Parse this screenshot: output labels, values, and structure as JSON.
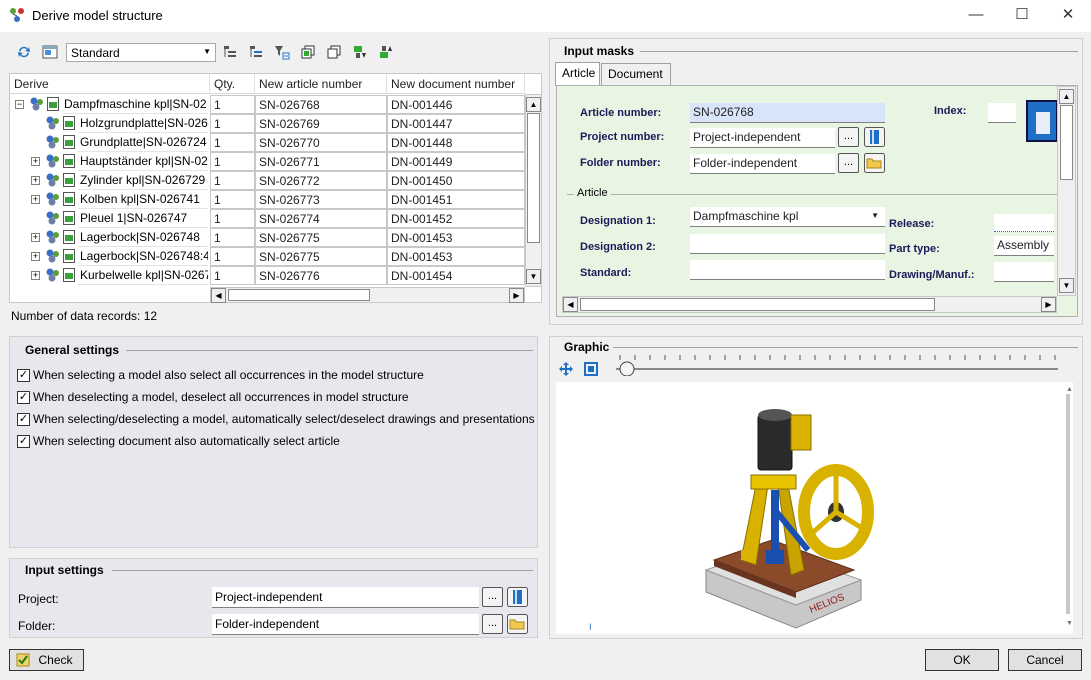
{
  "window": {
    "title": "Derive model structure",
    "minimize": "—",
    "maximize": "☐",
    "close": "✕"
  },
  "toolbar": {
    "view_combo": "Standard"
  },
  "tree": {
    "columns": [
      "Derive",
      "Qty.",
      "New article number",
      "New document number"
    ],
    "rows": [
      {
        "name": "Dampfmaschine kpl|SN-02",
        "qty": "1",
        "art": "SN-026768",
        "doc": "DN-001446",
        "expander": "−",
        "level": 0
      },
      {
        "name": "Holzgrundplatte|SN-026",
        "qty": "1",
        "art": "SN-026769",
        "doc": "DN-001447",
        "expander": "",
        "level": 1
      },
      {
        "name": "Grundplatte|SN-026724",
        "qty": "1",
        "art": "SN-026770",
        "doc": "DN-001448",
        "expander": "",
        "level": 1
      },
      {
        "name": "Hauptständer kpl|SN-02",
        "qty": "1",
        "art": "SN-026771",
        "doc": "DN-001449",
        "expander": "+",
        "level": 1
      },
      {
        "name": "Zylinder kpl|SN-026729",
        "qty": "1",
        "art": "SN-026772",
        "doc": "DN-001450",
        "expander": "+",
        "level": 1
      },
      {
        "name": "Kolben kpl|SN-026741",
        "qty": "1",
        "art": "SN-026773",
        "doc": "DN-001451",
        "expander": "+",
        "level": 1
      },
      {
        "name": "Pleuel 1|SN-026747",
        "qty": "1",
        "art": "SN-026774",
        "doc": "DN-001452",
        "expander": "",
        "level": 1
      },
      {
        "name": "Lagerbock|SN-026748",
        "qty": "1",
        "art": "SN-026775",
        "doc": "DN-001453",
        "expander": "+",
        "level": 1
      },
      {
        "name": "Lagerbock|SN-026748:4",
        "qty": "1",
        "art": "SN-026775",
        "doc": "DN-001453",
        "expander": "+",
        "level": 1
      },
      {
        "name": "Kurbelwelle kpl|SN-0267",
        "qty": "1",
        "art": "SN-026776",
        "doc": "DN-001454",
        "expander": "+",
        "level": 1
      }
    ],
    "record_count": "Number of data records: 12"
  },
  "input_masks": {
    "title": "Input masks",
    "tabs": [
      "Article",
      "Document"
    ],
    "article_number_label": "Article number:",
    "article_number_value": "SN-026768",
    "index_label": "Index:",
    "project_number_label": "Project number:",
    "project_number_value": "Project-independent",
    "folder_number_label": "Folder number:",
    "folder_number_value": "Folder-independent",
    "group_title": "Article",
    "designation1_label": "Designation 1:",
    "designation1_value": "Dampfmaschine kpl",
    "designation2_label": "Designation 2:",
    "standard_label": "Standard:",
    "release_label": "Release:",
    "part_type_label": "Part type:",
    "part_type_value": "Assembly",
    "drawing_label": "Drawing/Manuf.:",
    "browse_label": "..."
  },
  "general_settings": {
    "title": "General settings",
    "options": [
      "When selecting a model also select all occurrences in the model structure",
      "When deselecting a model, deselect all occurrences in model structure",
      "When selecting/deselecting a model, automatically select/deselect drawings and presentations",
      "When selecting document also automatically select article"
    ],
    "checkmark": "✓"
  },
  "graphic": {
    "title": "Graphic",
    "brand_text": "HELIOS",
    "axis_mark": "I"
  },
  "input_settings": {
    "title": "Input settings",
    "project_label": "Project:",
    "project_value": "Project-independent",
    "folder_label": "Folder:",
    "folder_value": "Folder-independent"
  },
  "footer": {
    "check": "Check",
    "ok": "OK",
    "cancel": "Cancel"
  },
  "colors": {
    "mask_bg": "#e8f5e2",
    "accent_blue": "#1f6fc6",
    "selected_field": "#d8e4fa"
  }
}
